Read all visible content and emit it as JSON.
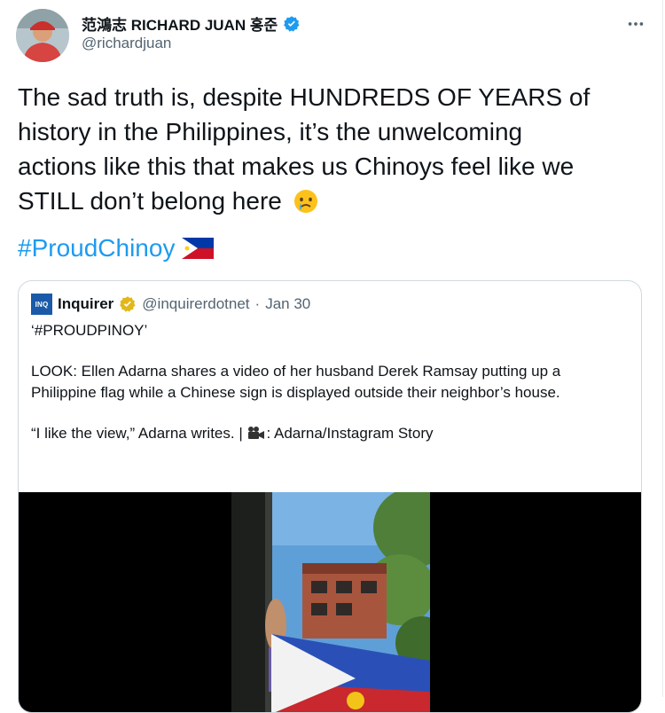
{
  "tweet": {
    "author": {
      "display_name": "范鴻志 RICHARD JUAN 홍준",
      "handle": "@richardjuan",
      "verified": true
    },
    "text_lines": [
      "The sad truth is, despite HUNDREDS OF YEARS of",
      "history in the Philippines, it’s the unwelcoming",
      "actions like this that makes us Chinoys feel like we",
      "STILL don’t belong here"
    ],
    "emoji": "crying-face",
    "hashtag": "#ProudChinoy",
    "flag": "philippines-flag"
  },
  "quote": {
    "logo_text": "INQ",
    "name": "Inquirer",
    "handle": "@inquirerdotnet",
    "separator": "·",
    "date": "Jan 30",
    "title": "‘#PROUDPINOY’",
    "body": "LOOK: Ellen Adarna shares a video of her husband Derek Ramsay putting up a Philippine flag while a Chinese sign is displayed outside their neighbor’s house.",
    "quote_line_before": "“I like the view,” Adarna writes. |",
    "quote_line_after": ": Adarna/Instagram Story"
  },
  "colors": {
    "link": "#1d9bf0",
    "secondary_text": "#536471",
    "verified_blue": "#1d9bf0",
    "verified_gold": "#e2b719"
  }
}
